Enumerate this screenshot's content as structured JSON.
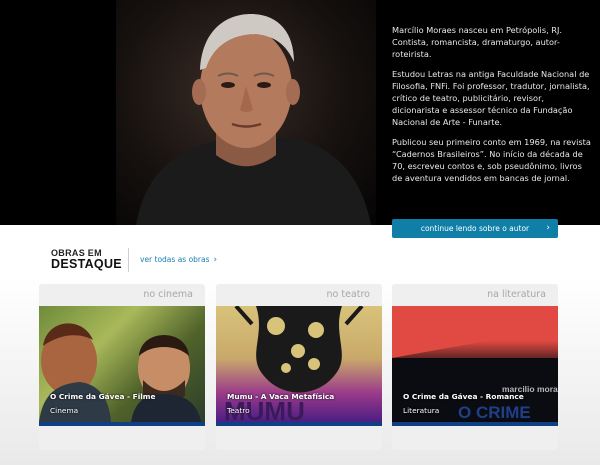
{
  "hero": {
    "bio": [
      "Marcílio Moraes nasceu em Petrópolis, RJ. Contista, romancista, dramaturgo, autor-roteirista.",
      "Estudou Letras na antiga Faculdade Nacional de Filosofia, FNFi. Foi professor, tradutor, jornalista, crítico de teatro, publicitário, revisor, dicionarista e assessor técnico da Fundação Nacional de Arte - Funarte.",
      "Publicou seu primeiro conto em 1969, na revista “Cadernos Brasileiros”. No início da década de 70, escreveu contos e, sob pseudônimo, livros de aventura vendidos em bancas de jornal."
    ],
    "continue_label": "continue lendo sobre o autor",
    "continue_icon": "chevron-right-icon"
  },
  "featured": {
    "title_line1": "OBRAS EM",
    "title_line2": "DESTAQUE",
    "see_all_label": "ver todas as obras",
    "see_all_icon": "chevron-right-icon"
  },
  "cards": [
    {
      "category": "no cinema",
      "title": "O Crime da Gávea - Filme",
      "type": "Cinema"
    },
    {
      "category": "no teatro",
      "title": "Mumu - A Vaca Metafísica",
      "type": "Teatro"
    },
    {
      "category": "na literatura",
      "title": "O Crime da Gávea - Romance",
      "type": "Literatura",
      "cover_author": "marcilio moraes",
      "cover_title": "O CRIME"
    }
  ],
  "colors": {
    "accent": "#0f7fa8",
    "card_bar": "#103f85",
    "link": "#1a7fb0"
  }
}
